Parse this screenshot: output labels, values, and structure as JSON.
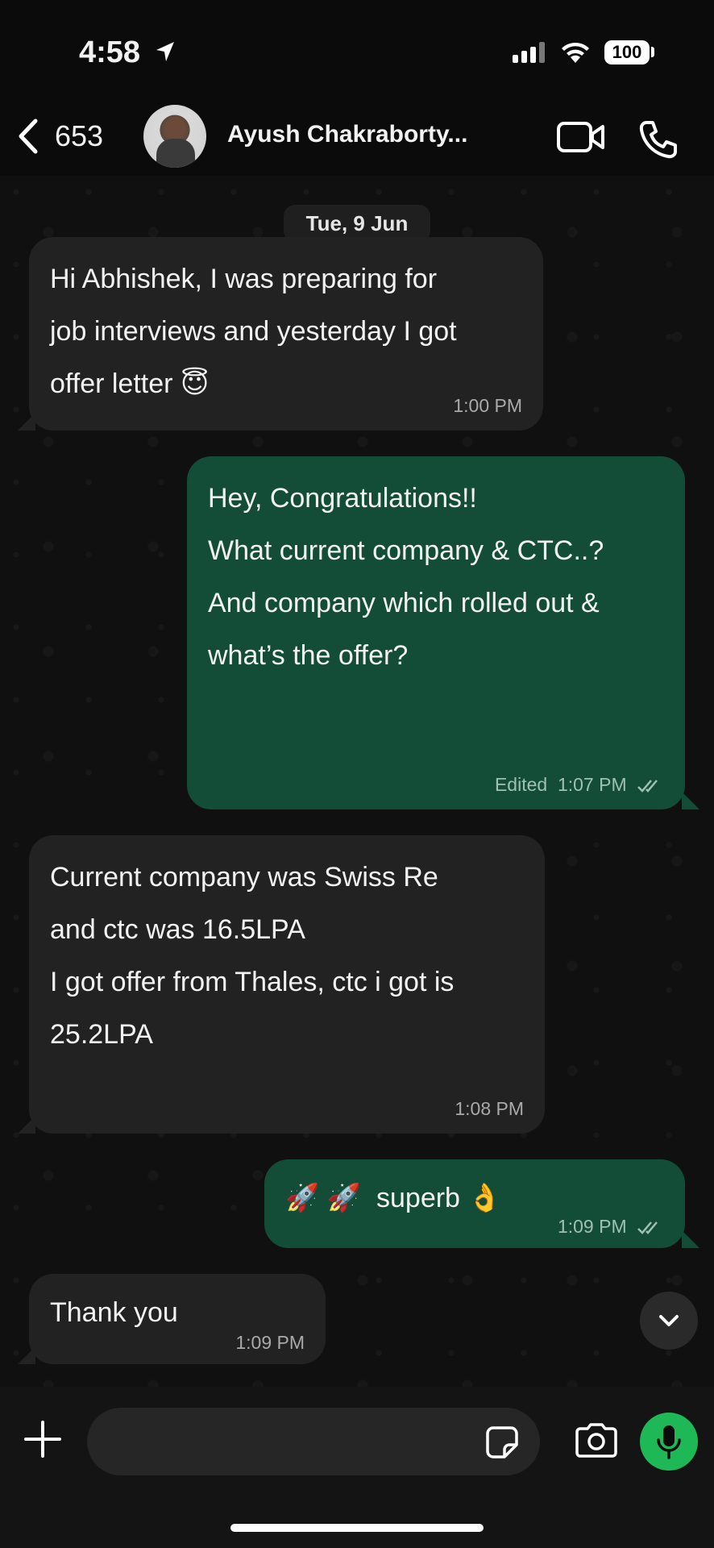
{
  "status_bar": {
    "time": "4:58",
    "battery": "100"
  },
  "header": {
    "back_count": "653",
    "contact_name": "Ayush Chakraborty..."
  },
  "date_chip": "Tue, 9 Jun",
  "messages": [
    {
      "direction": "in",
      "lines": [
        "Hi Abhishek, I was preparing for",
        "job interviews and yesterday I got",
        "offer letter 😇"
      ],
      "time": "1:00 PM"
    },
    {
      "direction": "out",
      "lines": [
        "Hey, Congratulations!!",
        "",
        "What current company & CTC..?",
        "",
        "And company which rolled out &",
        "what’s the offer?"
      ],
      "edited": "Edited",
      "time": "1:07 PM"
    },
    {
      "direction": "in",
      "lines": [
        "Current company was Swiss Re",
        "and ctc was 16.5LPA",
        "",
        "I got offer from Thales, ctc i got is",
        "25.2LPA"
      ],
      "time": "1:08 PM"
    },
    {
      "direction": "out",
      "lines": [
        "🚀 🚀  superb 👌"
      ],
      "time": "1:09 PM"
    },
    {
      "direction": "in",
      "lines": [
        "Thank you"
      ],
      "time": "1:09 PM"
    }
  ],
  "input": {
    "placeholder": ""
  },
  "colors": {
    "incoming_bubble": "#222222",
    "outgoing_bubble": "#144d37",
    "mic_button": "#1fb856"
  }
}
